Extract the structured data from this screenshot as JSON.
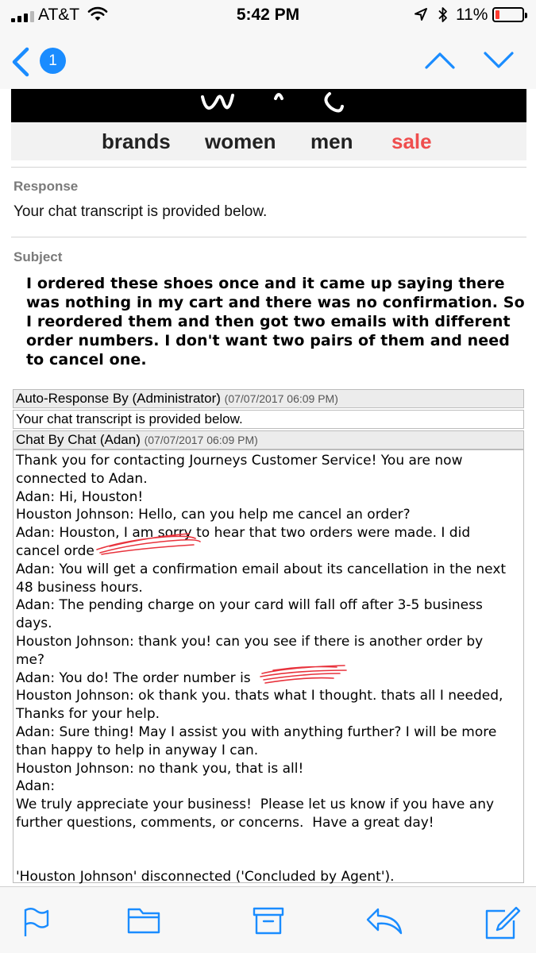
{
  "status_bar": {
    "carrier": "AT&T",
    "time": "5:42 PM",
    "battery_percent": "11%",
    "battery_color": "#ff3b30",
    "icons": [
      "signal-icon",
      "wifi-icon",
      "location-arrow-icon",
      "bluetooth-icon",
      "battery-icon"
    ]
  },
  "nav": {
    "back_badge": "1",
    "accent_color": "#1a8cff",
    "icons": [
      "chevron-left-icon",
      "chevron-up-icon",
      "chevron-down-icon"
    ]
  },
  "email": {
    "brand_nav": [
      "brands",
      "women",
      "men",
      "sale"
    ],
    "sale_color": "#ef4e4e",
    "response_label": "Response",
    "response_text": "Your chat transcript is provided below.",
    "subject_label": "Subject",
    "subject_text": "I ordered these shoes once and it came up saying there was nothing in my cart and there was no confirmation. So I reordered them and then got two emails with different order numbers. I don't want two pairs of them and need to cancel one.",
    "transcript": {
      "auto_header": "Auto-Response By (Administrator)",
      "auto_date": "(07/07/2017 06:09 PM)",
      "auto_text": "Your chat transcript is provided below.",
      "chat_header": "Chat By Chat (Adan)",
      "chat_date": "(07/07/2017 06:09 PM)",
      "lines": [
        "Thank you for contacting Journeys Customer Service! You are now",
        "connected to Adan.",
        "Adan: Hi, Houston!",
        "Houston Johnson: Hello, can you help me cancel an order?",
        "Adan: Houston, I am sorry to hear that two orders were made. I did",
        "cancel orde",
        "Adan: You will get a confirmation email about its cancellation in the next",
        "48 business hours.",
        "Adan: The pending charge on your card will fall off after 3-5 business",
        "days.",
        "Houston Johnson: thank you! can you see if there is another order by",
        "me?",
        "Adan: You do! The order number is",
        "Houston Johnson: ok thank you. thats what I thought. thats all I needed,",
        "Thanks for your help.",
        "Adan: Sure thing! May I assist you with anything further? I will be more",
        "than happy to help in anyway I can.",
        "Houston Johnson: no thank you, that is all!",
        "Adan:",
        "We truly appreciate your business!  Please let us know if you have any",
        "further questions, comments, or concerns.  Have a great day!",
        "",
        "",
        "'Houston Johnson' disconnected ('Concluded by Agent')."
      ]
    }
  },
  "toolbar": {
    "icons": [
      "flag-icon",
      "folder-icon",
      "archive-icon",
      "reply-icon",
      "compose-icon"
    ]
  }
}
